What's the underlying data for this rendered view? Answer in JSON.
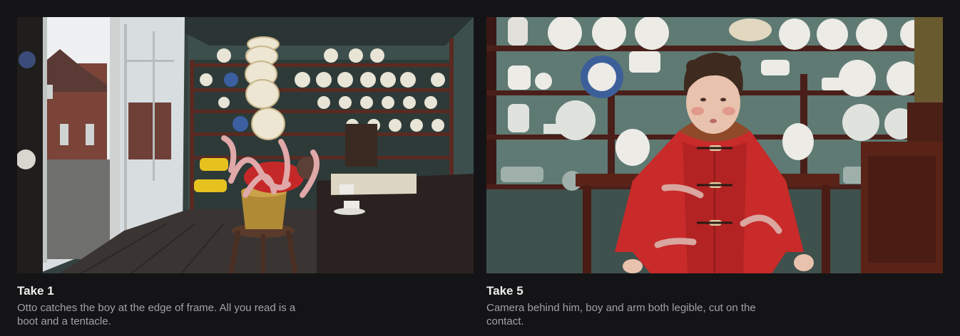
{
  "takes": [
    {
      "title": "Take 1",
      "caption": "Otto catches the boy at the edge of frame. All you read is a boot and a tentacle.",
      "frame_icon": "still-image",
      "palette": {
        "wall": "#3c4f4d",
        "shelf": "#5a2a22",
        "floor": "#3a3532",
        "window": "#e8ecee",
        "brick": "#7a4438",
        "coat": "#c52828",
        "boot": "#e6c21f",
        "tentacle": "#e0a8a8",
        "plate": "#e8e4d6",
        "bucket": "#b08a35"
      }
    },
    {
      "title": "Take 5",
      "caption": "Camera behind him, boy and arm both legible, cut on the contact.",
      "frame_icon": "still-image",
      "palette": {
        "wall": "#5e7a73",
        "shelf": "#4a1f1a",
        "coat": "#c92a2a",
        "hair": "#3e2a1e",
        "skin": "#e9c2ad",
        "toggle": "#e0caa0",
        "tentacle": "#d9a6a0",
        "plate": "#ecebe6",
        "blue_plate": "#3c5f9a",
        "cabinet": "#5a2318"
      }
    }
  ]
}
